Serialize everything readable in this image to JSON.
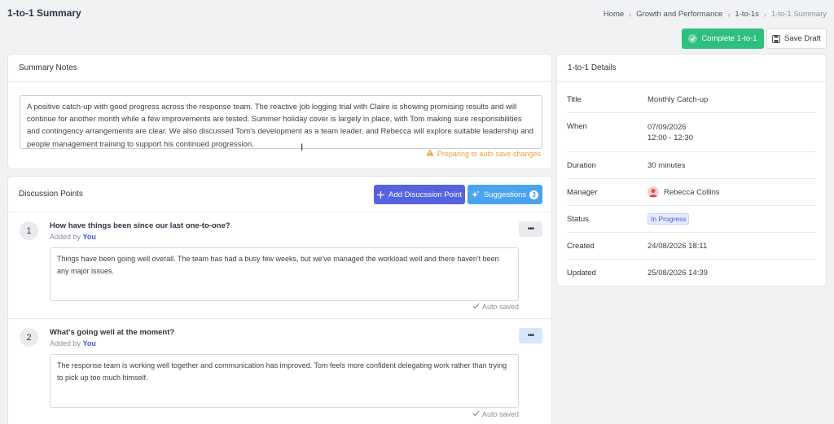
{
  "page": {
    "title": "1-to-1 Summary"
  },
  "breadcrumb": [
    "Home",
    "Growth and Performance",
    "1-to-1s",
    "1-to-1 Summary"
  ],
  "actions": {
    "complete_label": "Complete 1-to-1",
    "save_draft_label": "Save Draft"
  },
  "summary": {
    "header": "Summary Notes",
    "text": "A positive catch-up with good progress across the response team. The reactive job logging trial with Claire is showing promising results and will continue for another month while a few improvements are tested. Summer holiday cover is largely in place, with Tom making sure responsibilities and contingency arrangements are clear. We also discussed Tom's development as a team leader, and Rebecca will explore suitable leadership and people management training to support his continued progression.",
    "autosave_status": "Preparing to auto save changes"
  },
  "discussion": {
    "header": "Discussion Points",
    "add_label": "Add Disucssion Point",
    "suggestions_label": "Suggestions",
    "suggestions_count": "3",
    "points": [
      {
        "number": "1",
        "question": "How have things been since our last one-to-one?",
        "added_by_prefix": "Added by",
        "added_by": "You",
        "answer": "Things have been going well overall. The team has had a busy few weeks, but we've managed the workload well and there haven't been any major issues.",
        "saved_status": "Auto saved"
      },
      {
        "number": "2",
        "question": "What's going well at the moment?",
        "added_by_prefix": "Added by",
        "added_by": "You",
        "answer": "The response team is working well together and communication has improved. Tom feels more confident delegating work rather than trying to pick up too much himself.",
        "saved_status": "Auto saved"
      }
    ]
  },
  "details": {
    "header": "1-to-1 Details",
    "rows": {
      "title": {
        "label": "Title",
        "value": "Monthly Catch-up"
      },
      "when": {
        "label": "When",
        "date": "07/09/2026",
        "time": "12:00 - 12:30"
      },
      "duration": {
        "label": "Duration",
        "value": "30 minutes"
      },
      "manager": {
        "label": "Manager",
        "value": "Rebecca Collins"
      },
      "status": {
        "label": "Status",
        "value": "In Progress"
      },
      "created": {
        "label": "Created",
        "value": "24/08/2026 18:11"
      },
      "updated": {
        "label": "Updated",
        "value": "25/08/2026 14:39"
      }
    }
  },
  "colors": {
    "complete": "#2fbf7f",
    "add_point": "#5563e0",
    "suggestions": "#4aa3ef",
    "warning": "#e7a23a",
    "link": "#4156d6"
  }
}
